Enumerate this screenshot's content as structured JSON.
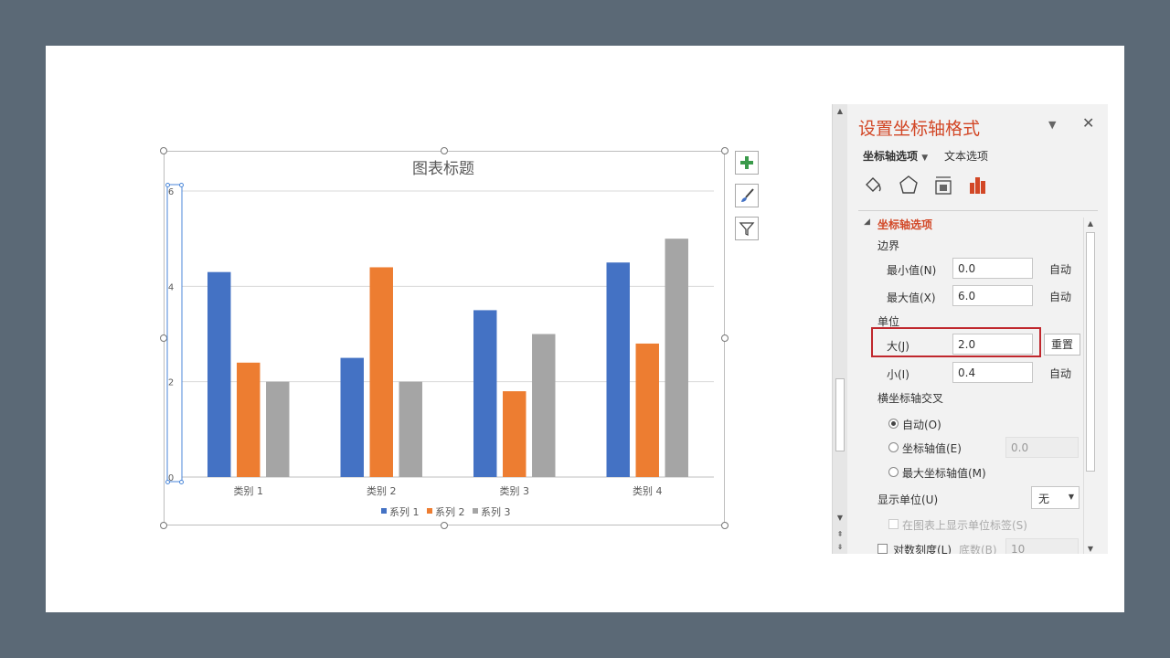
{
  "chart_data": {
    "type": "bar",
    "title": "图表标题",
    "categories": [
      "类别 1",
      "类别 2",
      "类别 3",
      "类别 4"
    ],
    "series": [
      {
        "name": "系列 1",
        "color": "#4472c4",
        "values": [
          4.3,
          2.5,
          3.5,
          4.5
        ]
      },
      {
        "name": "系列 2",
        "color": "#ed7d31",
        "values": [
          2.4,
          4.4,
          1.8,
          2.8
        ]
      },
      {
        "name": "系列 3",
        "color": "#a5a5a5",
        "values": [
          2.0,
          2.0,
          3.0,
          5.0
        ]
      }
    ],
    "yticks": [
      "0",
      "2",
      "4",
      "6"
    ],
    "ylim": [
      0,
      6
    ],
    "grid": true,
    "legend_position": "bottom"
  },
  "chart_tools": {
    "add_icon": "plus-icon",
    "style_icon": "brush-icon",
    "filter_icon": "filter-icon"
  },
  "pane": {
    "title": "设置坐标轴格式",
    "tabs": {
      "axis_options": "坐标轴选项",
      "text_options": "文本选项"
    },
    "section_title": "坐标轴选项",
    "bounds": {
      "label": "边界",
      "min_label": "最小值(N)",
      "min_value": "0.0",
      "min_state": "自动",
      "max_label": "最大值(X)",
      "max_value": "6.0",
      "max_state": "自动"
    },
    "units": {
      "label": "单位",
      "major_label": "大(J)",
      "major_value": "2.0",
      "reset_label": "重置",
      "minor_label": "小(I)",
      "minor_value": "0.4",
      "minor_state": "自动"
    },
    "crosses": {
      "label": "横坐标轴交叉",
      "auto_label": "自动(O)",
      "value_label": "坐标轴值(E)",
      "value_value": "0.0",
      "max_label": "最大坐标轴值(M)"
    },
    "display_units": {
      "label": "显示单位(U)",
      "value": "无",
      "show_label": "在图表上显示单位标签(S)"
    },
    "log_scale": {
      "label": "对数刻度(L)",
      "base_label": "底数(B)",
      "base_value": "10"
    },
    "accent_color": "#d24726",
    "highlight_color": "#c0272d"
  }
}
